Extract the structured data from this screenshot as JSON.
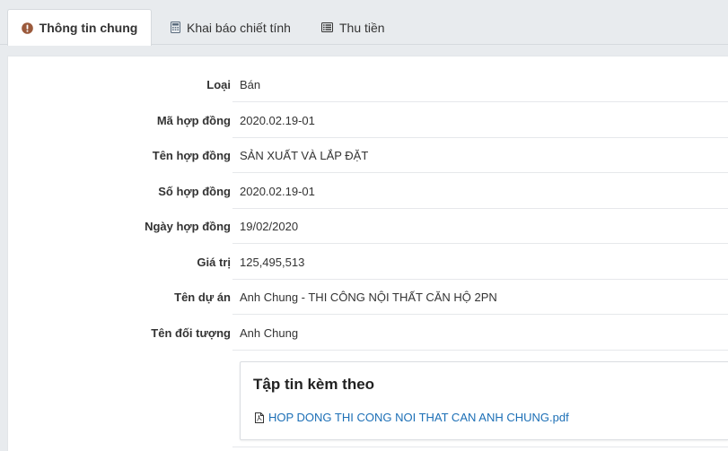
{
  "tabs": [
    {
      "label": "Thông tin chung",
      "icon": "exclamation-circle-icon",
      "active": true
    },
    {
      "label": "Khai báo chiết tính",
      "icon": "calculator-icon",
      "active": false
    },
    {
      "label": "Thu tiền",
      "icon": "list-alt-icon",
      "active": false
    }
  ],
  "details": {
    "rows": [
      {
        "label": "Loại",
        "value": "Bán"
      },
      {
        "label": "Mã hợp đồng",
        "value": "2020.02.19-01"
      },
      {
        "label": "Tên hợp đồng",
        "value": "SẢN XUẤT VÀ LẮP ĐẶT"
      },
      {
        "label": "Số hợp đồng",
        "value": "2020.02.19-01"
      },
      {
        "label": "Ngày hợp đồng",
        "value": "19/02/2020"
      },
      {
        "label": "Giá trị",
        "value": "125,495,513"
      },
      {
        "label": "Tên dự án",
        "value": "Anh Chung - THI CÔNG NỘI THẤT CĂN HỘ 2PN"
      },
      {
        "label": "Tên đối tượng",
        "value": "Anh Chung"
      }
    ]
  },
  "attachments": {
    "title": "Tập tin kèm theo",
    "files": [
      {
        "name": "HOP DONG THI CONG NOI THAT CAN ANH CHUNG.pdf",
        "icon": "file-pdf-icon"
      }
    ]
  },
  "colors": {
    "tab_icon_active": "#9b5a3c",
    "tab_icon": "#5a6b7d",
    "link": "#1c6fb6"
  }
}
